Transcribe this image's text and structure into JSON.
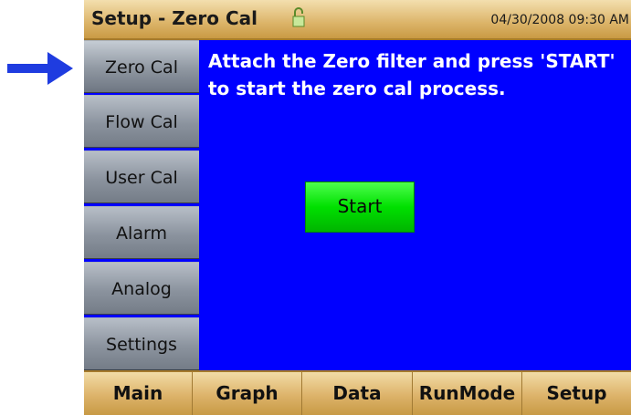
{
  "title_bar": {
    "title": "Setup - Zero Cal",
    "lock_icon": "lock-icon",
    "datetime": "04/30/2008 09:30 AM"
  },
  "sidebar": {
    "items": [
      {
        "label": "Zero Cal",
        "active": true
      },
      {
        "label": "Flow Cal",
        "active": false
      },
      {
        "label": "User Cal",
        "active": false
      },
      {
        "label": "Alarm",
        "active": false
      },
      {
        "label": "Analog",
        "active": false
      },
      {
        "label": "Settings",
        "active": false
      }
    ]
  },
  "main": {
    "instruction": "Attach the Zero filter and press 'START'\nto start the zero cal process.",
    "start_label": "Start"
  },
  "bottom_nav": {
    "tabs": [
      {
        "label": "Main"
      },
      {
        "label": "Graph"
      },
      {
        "label": "Data"
      },
      {
        "label": "RunMode"
      },
      {
        "label": "Setup"
      }
    ]
  },
  "annotation": {
    "pointer": "arrow-right-icon"
  },
  "colors": {
    "screen_background": "#0000ff",
    "header_gold": "#dcb469",
    "start_green": "#00e000",
    "pointer_blue": "#1f3ce0"
  }
}
